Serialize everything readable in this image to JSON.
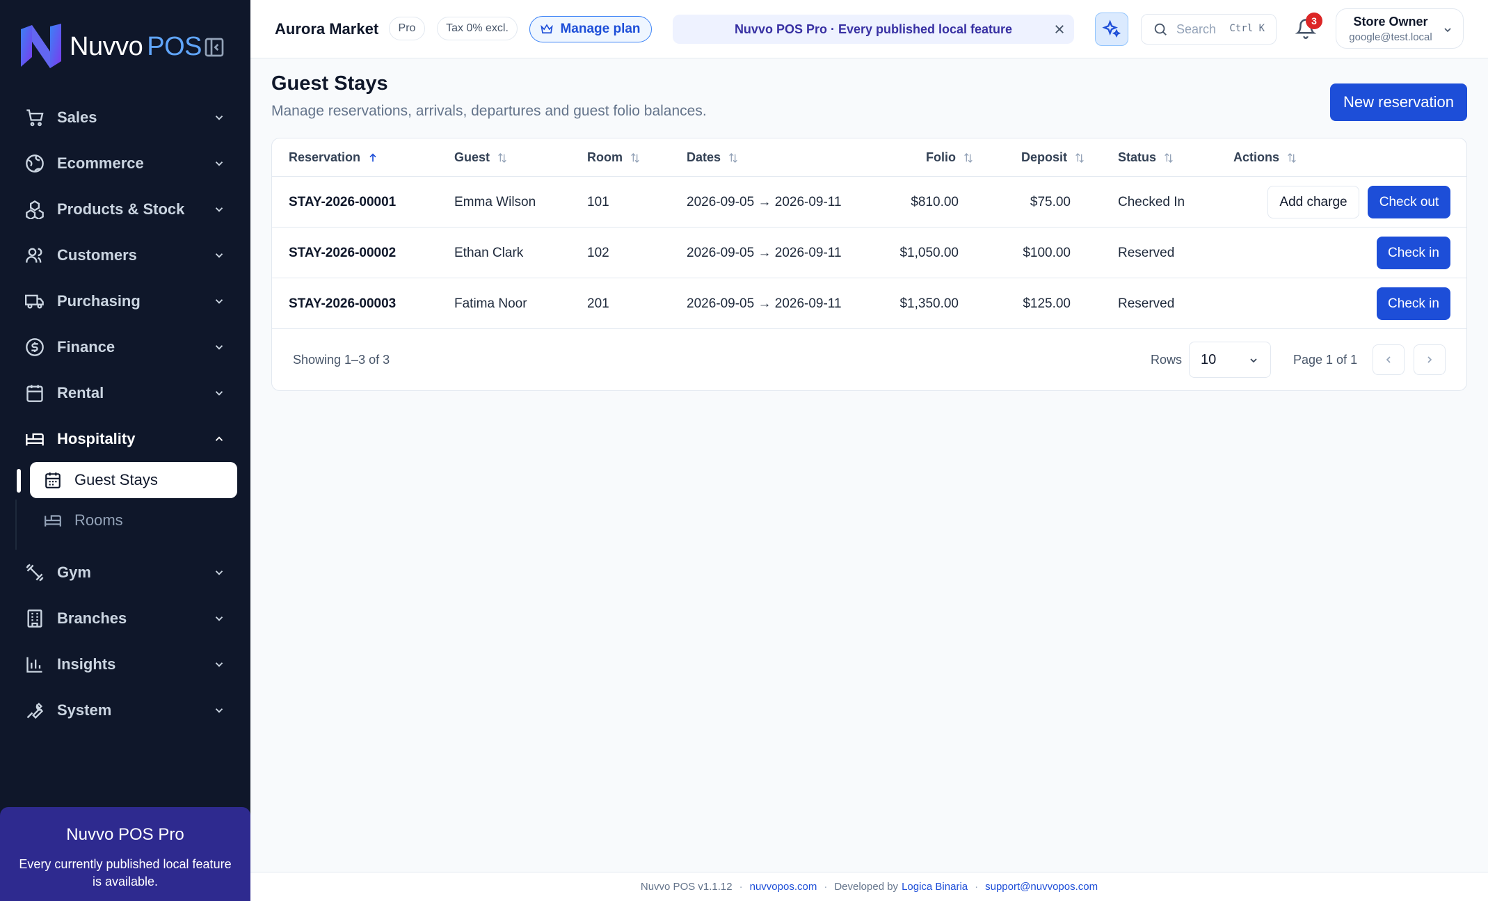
{
  "brand": {
    "name": "Nuvvo",
    "suffix": "POS"
  },
  "nav": {
    "items": [
      {
        "label": "Sales",
        "icon": "cart-icon"
      },
      {
        "label": "Ecommerce",
        "icon": "globe-icon"
      },
      {
        "label": "Products & Stock",
        "icon": "boxes-icon"
      },
      {
        "label": "Customers",
        "icon": "users-icon"
      },
      {
        "label": "Purchasing",
        "icon": "truck-icon"
      },
      {
        "label": "Finance",
        "icon": "dollar-circle-icon"
      },
      {
        "label": "Rental",
        "icon": "calendar-icon"
      },
      {
        "label": "Hospitality",
        "icon": "bed-icon"
      },
      {
        "label": "Gym",
        "icon": "dumbbell-icon"
      },
      {
        "label": "Branches",
        "icon": "building-icon"
      },
      {
        "label": "Insights",
        "icon": "bar-chart-icon"
      },
      {
        "label": "System",
        "icon": "wrench-icon"
      }
    ],
    "hospitality_sub": [
      {
        "label": "Guest Stays",
        "icon": "calendar-icon",
        "active": true
      },
      {
        "label": "Rooms",
        "icon": "bed-icon",
        "active": false
      }
    ]
  },
  "promo": {
    "title": "Nuvvo POS Pro",
    "text": "Every currently published local feature is available."
  },
  "header": {
    "store_name": "Aurora Market",
    "plan_badge": "Pro",
    "tax_badge": "Tax 0% excl.",
    "manage_plan": "Manage plan",
    "banner": "Nuvvo POS Pro · Every published local feature",
    "search_placeholder": "Search",
    "search_shortcut": "Ctrl K",
    "notification_count": "3",
    "user_name": "Store Owner",
    "user_email": "google@test.local"
  },
  "page": {
    "title": "Guest Stays",
    "subtitle": "Manage reservations, arrivals, departures and guest folio balances.",
    "new_button": "New reservation"
  },
  "table": {
    "columns": [
      "Reservation",
      "Guest",
      "Room",
      "Dates",
      "Folio",
      "Deposit",
      "Status",
      "Actions"
    ],
    "rows": [
      {
        "reservation": "STAY-2026-00001",
        "guest": "Emma Wilson",
        "room": "101",
        "dates": "2026-09-05 → 2026-09-11",
        "folio": "$810.00",
        "deposit": "$75.00",
        "status": "Checked In",
        "secondary_action": "Add charge",
        "primary_action": "Check out"
      },
      {
        "reservation": "STAY-2026-00002",
        "guest": "Ethan Clark",
        "room": "102",
        "dates": "2026-09-05 → 2026-09-11",
        "folio": "$1,050.00",
        "deposit": "$100.00",
        "status": "Reserved",
        "primary_action": "Check in"
      },
      {
        "reservation": "STAY-2026-00003",
        "guest": "Fatima Noor",
        "room": "201",
        "dates": "2026-09-05 → 2026-09-11",
        "folio": "$1,350.00",
        "deposit": "$125.00",
        "status": "Reserved",
        "primary_action": "Check in"
      }
    ],
    "showing": "Showing 1–3 of 3",
    "rows_label": "Rows",
    "rows_value": "10",
    "page_info": "Page 1 of 1"
  },
  "footer": {
    "version": "Nuvvo POS v1.1.12",
    "site": "nuvvopos.com",
    "developed_by": "Developed by",
    "developer": "Logica Binaria",
    "email": "support@nuvvopos.com"
  },
  "colors": {
    "sidebar_bg": "#0f172a",
    "accent": "#1d4ed8",
    "promo_bg": "#2e2a8f",
    "badge_red": "#dc2626"
  }
}
